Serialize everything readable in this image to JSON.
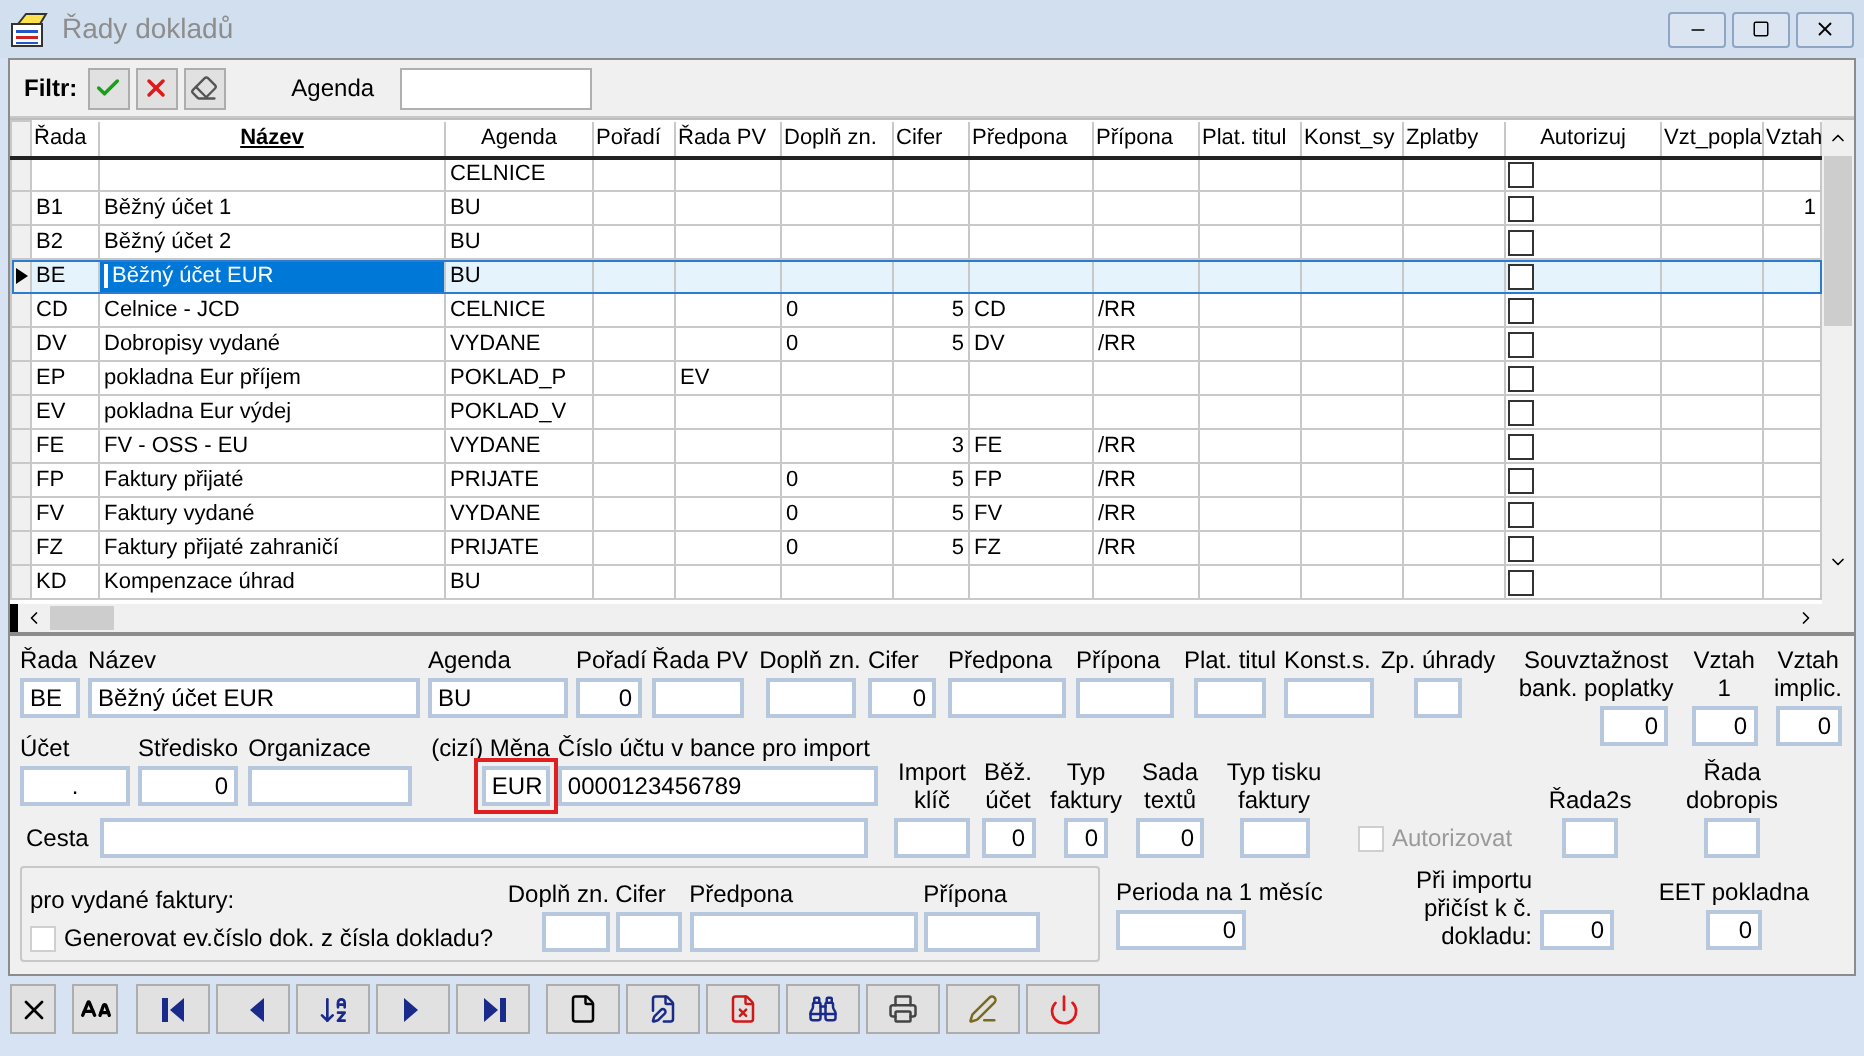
{
  "window": {
    "title": "Řady dokladů"
  },
  "filter": {
    "label": "Filtr:",
    "agenda_label": "Agenda"
  },
  "grid": {
    "columns": [
      {
        "label": "Řada",
        "kind": "text",
        "sorted": false,
        "focused": false
      },
      {
        "label": "Název",
        "kind": "text",
        "sorted": true,
        "focused": true
      },
      {
        "label": "Agenda",
        "kind": "text",
        "sorted": false,
        "focused": false
      },
      {
        "label": "Pořadí",
        "kind": "number",
        "sorted": false,
        "focused": false
      },
      {
        "label": "Řada PV",
        "kind": "text",
        "sorted": false,
        "focused": false
      },
      {
        "label": "Doplň zn.",
        "kind": "text",
        "sorted": false,
        "focused": false
      },
      {
        "label": "Cifer",
        "kind": "number",
        "sorted": false,
        "focused": false
      },
      {
        "label": "Předpona",
        "kind": "text",
        "sorted": false,
        "focused": false
      },
      {
        "label": "Přípona",
        "kind": "text",
        "sorted": false,
        "focused": false
      },
      {
        "label": "Plat. titul",
        "kind": "text",
        "sorted": false,
        "focused": false
      },
      {
        "label": "Konst_sy",
        "kind": "text",
        "sorted": false,
        "focused": false
      },
      {
        "label": "Zplatby",
        "kind": "text",
        "sorted": false,
        "focused": false
      },
      {
        "label": "Autorizuj",
        "kind": "check",
        "sorted": false,
        "focused": false
      },
      {
        "label": "Vzt_popla",
        "kind": "text",
        "sorted": false,
        "focused": false
      },
      {
        "label": "Vztah",
        "kind": "number",
        "sorted": false,
        "focused": false
      }
    ],
    "rows": [
      {
        "selected": false,
        "cells": [
          null,
          null,
          "CELNICE",
          null,
          null,
          null,
          null,
          null,
          null,
          null,
          null,
          null,
          {
            "checked": false
          },
          null,
          null
        ]
      },
      {
        "selected": false,
        "cells": [
          "B1",
          "Běžný účet 1",
          "BU",
          null,
          null,
          null,
          null,
          null,
          null,
          null,
          null,
          null,
          {
            "checked": false
          },
          null,
          "1"
        ]
      },
      {
        "selected": false,
        "cells": [
          "B2",
          "Běžný účet 2",
          "BU",
          null,
          null,
          null,
          null,
          null,
          null,
          null,
          null,
          null,
          {
            "checked": false
          },
          null,
          null
        ]
      },
      {
        "selected": true,
        "cells": [
          "BE",
          "Běžný účet EUR",
          "BU",
          null,
          null,
          null,
          null,
          null,
          null,
          null,
          null,
          null,
          {
            "checked": false
          },
          null,
          null
        ]
      },
      {
        "selected": false,
        "cells": [
          "CD",
          "Celnice - JCD",
          "CELNICE",
          null,
          null,
          "0",
          "5",
          "CD",
          "/RR",
          null,
          null,
          null,
          {
            "checked": false
          },
          null,
          null
        ]
      },
      {
        "selected": false,
        "cells": [
          "DV",
          "Dobropisy vydané",
          "VYDANE",
          null,
          null,
          "0",
          "5",
          "DV",
          "/RR",
          null,
          null,
          null,
          {
            "checked": false
          },
          null,
          null
        ]
      },
      {
        "selected": false,
        "cells": [
          "EP",
          "pokladna Eur příjem",
          "POKLAD_P",
          null,
          "EV",
          null,
          null,
          null,
          null,
          null,
          null,
          null,
          {
            "checked": false
          },
          null,
          null
        ]
      },
      {
        "selected": false,
        "cells": [
          "EV",
          "pokladna Eur výdej",
          "POKLAD_V",
          null,
          null,
          null,
          null,
          null,
          null,
          null,
          null,
          null,
          {
            "checked": false
          },
          null,
          null
        ]
      },
      {
        "selected": false,
        "cells": [
          "FE",
          "FV - OSS - EU",
          "VYDANE",
          null,
          null,
          null,
          "3",
          "FE",
          "/RR",
          null,
          null,
          null,
          {
            "checked": false
          },
          null,
          null
        ]
      },
      {
        "selected": false,
        "cells": [
          "FP",
          "Faktury přijaté",
          "PRIJATE",
          null,
          null,
          "0",
          "5",
          "FP",
          "/RR",
          null,
          null,
          null,
          {
            "checked": false
          },
          null,
          null
        ]
      },
      {
        "selected": false,
        "cells": [
          "FV",
          "Faktury vydané",
          "VYDANE",
          null,
          null,
          "0",
          "5",
          "FV",
          "/RR",
          null,
          null,
          null,
          {
            "checked": false
          },
          null,
          null
        ]
      },
      {
        "selected": false,
        "cells": [
          "FZ",
          "Faktury přijaté zahraničí",
          "PRIJATE",
          null,
          null,
          "0",
          "5",
          "FZ",
          "/RR",
          null,
          null,
          null,
          {
            "checked": false
          },
          null,
          null
        ]
      },
      {
        "selected": false,
        "cells": [
          "KD",
          "Kompenzace úhrad",
          "BU",
          null,
          null,
          null,
          null,
          null,
          null,
          null,
          null,
          null,
          {
            "checked": false
          },
          null,
          null
        ]
      }
    ]
  },
  "form": {
    "row1": [
      {
        "label": "Řada",
        "value": "BE",
        "kind": "text"
      },
      {
        "label": "Název",
        "value": "Běžný účet EUR",
        "kind": "text"
      },
      {
        "label": "Agenda",
        "value": "BU",
        "kind": "text"
      },
      {
        "label": "Pořadí",
        "value": "0",
        "kind": "number"
      },
      {
        "label": "Řada PV",
        "kind": "text"
      },
      {
        "label": "Doplň zn.",
        "kind": "text"
      },
      {
        "label": "Cifer",
        "value": "0",
        "kind": "number"
      },
      {
        "label": "Předpona",
        "kind": "text"
      },
      {
        "label": "Přípona",
        "kind": "text"
      },
      {
        "label": "Plat. titul",
        "kind": "text"
      },
      {
        "label": "Konst.s.",
        "kind": "text"
      },
      {
        "label": "Zp. úhrady",
        "kind": "text"
      }
    ],
    "row1_right": [
      {
        "label": "Souvztažnost bank. poplatky",
        "value": "0",
        "kind": "number"
      },
      {
        "label": "Vztah 1",
        "value": "0",
        "kind": "number"
      },
      {
        "label": "Vztah implic.",
        "value": "0",
        "kind": "number"
      }
    ],
    "row2": [
      {
        "label": "Účet",
        "value": ".",
        "kind": "center",
        "highlighted": false
      },
      {
        "label": "Středisko",
        "value": "0",
        "kind": "number",
        "highlighted": false
      },
      {
        "label": "Organizace",
        "kind": "text",
        "highlighted": false
      },
      {
        "label": "(cizí) Měna",
        "value": "EUR",
        "kind": "text",
        "highlighted": true
      },
      {
        "label": "Číslo účtu v bance pro import",
        "value": "0000123456789",
        "kind": "text",
        "highlighted": false
      }
    ],
    "path": {
      "label": "Cesta"
    },
    "row2_mid": [
      {
        "label": "Import klíč",
        "kind": "text"
      },
      {
        "label": "Běž. účet",
        "value": "0",
        "kind": "number"
      },
      {
        "label": "Typ faktury",
        "value": "0",
        "kind": "number"
      },
      {
        "label": "Sada textů",
        "value": "0",
        "kind": "number"
      },
      {
        "label": "Typ tisku faktury",
        "kind": "text"
      }
    ],
    "autorizovat": {
      "label": "Autorizovat",
      "checked": false,
      "disabled": true
    },
    "row2_right": [
      {
        "label": "Řada2s"
      },
      {
        "label": "Řada dobropis"
      }
    ],
    "issued_invoices": {
      "title": "pro vydané faktury:",
      "generate": {
        "label": "Generovat ev.číslo dok. z čísla dokladu?",
        "checked": false
      },
      "fields": [
        {
          "label": "Doplň zn."
        },
        {
          "label": "Cifer"
        },
        {
          "label": "Předpona"
        },
        {
          "label": "Přípona"
        }
      ]
    },
    "period": {
      "label": "Perioda na 1 měsíc",
      "value": "0",
      "kind": "number"
    },
    "import_add": {
      "label": "Při importu přičíst k č. dokladu:",
      "value": "0",
      "kind": "number"
    },
    "eet": {
      "label": "EET pokladna",
      "value": "0",
      "kind": "number"
    }
  }
}
